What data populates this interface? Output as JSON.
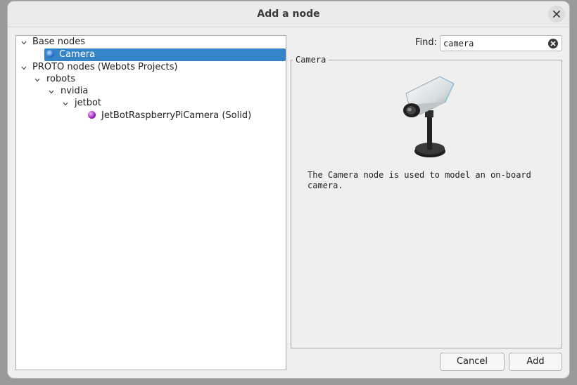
{
  "dialog": {
    "title": "Add a node"
  },
  "tree": {
    "base_nodes": "Base nodes",
    "camera": "Camera",
    "proto_nodes": "PROTO nodes (Webots Projects)",
    "robots": "robots",
    "nvidia": "nvidia",
    "jetbot": "jetbot",
    "jetbot_camera": "JetBotRaspberryPiCamera (Solid)"
  },
  "find": {
    "label": "Find:",
    "value": "camera"
  },
  "preview": {
    "title": "Camera",
    "description": "The Camera node is used to model an on-board camera."
  },
  "buttons": {
    "cancel": "Cancel",
    "add": "Add"
  },
  "colors": {
    "selection": "#3584c8",
    "base_node_icon": "#2a6fd0",
    "proto_node_icon": "#a020c0"
  }
}
